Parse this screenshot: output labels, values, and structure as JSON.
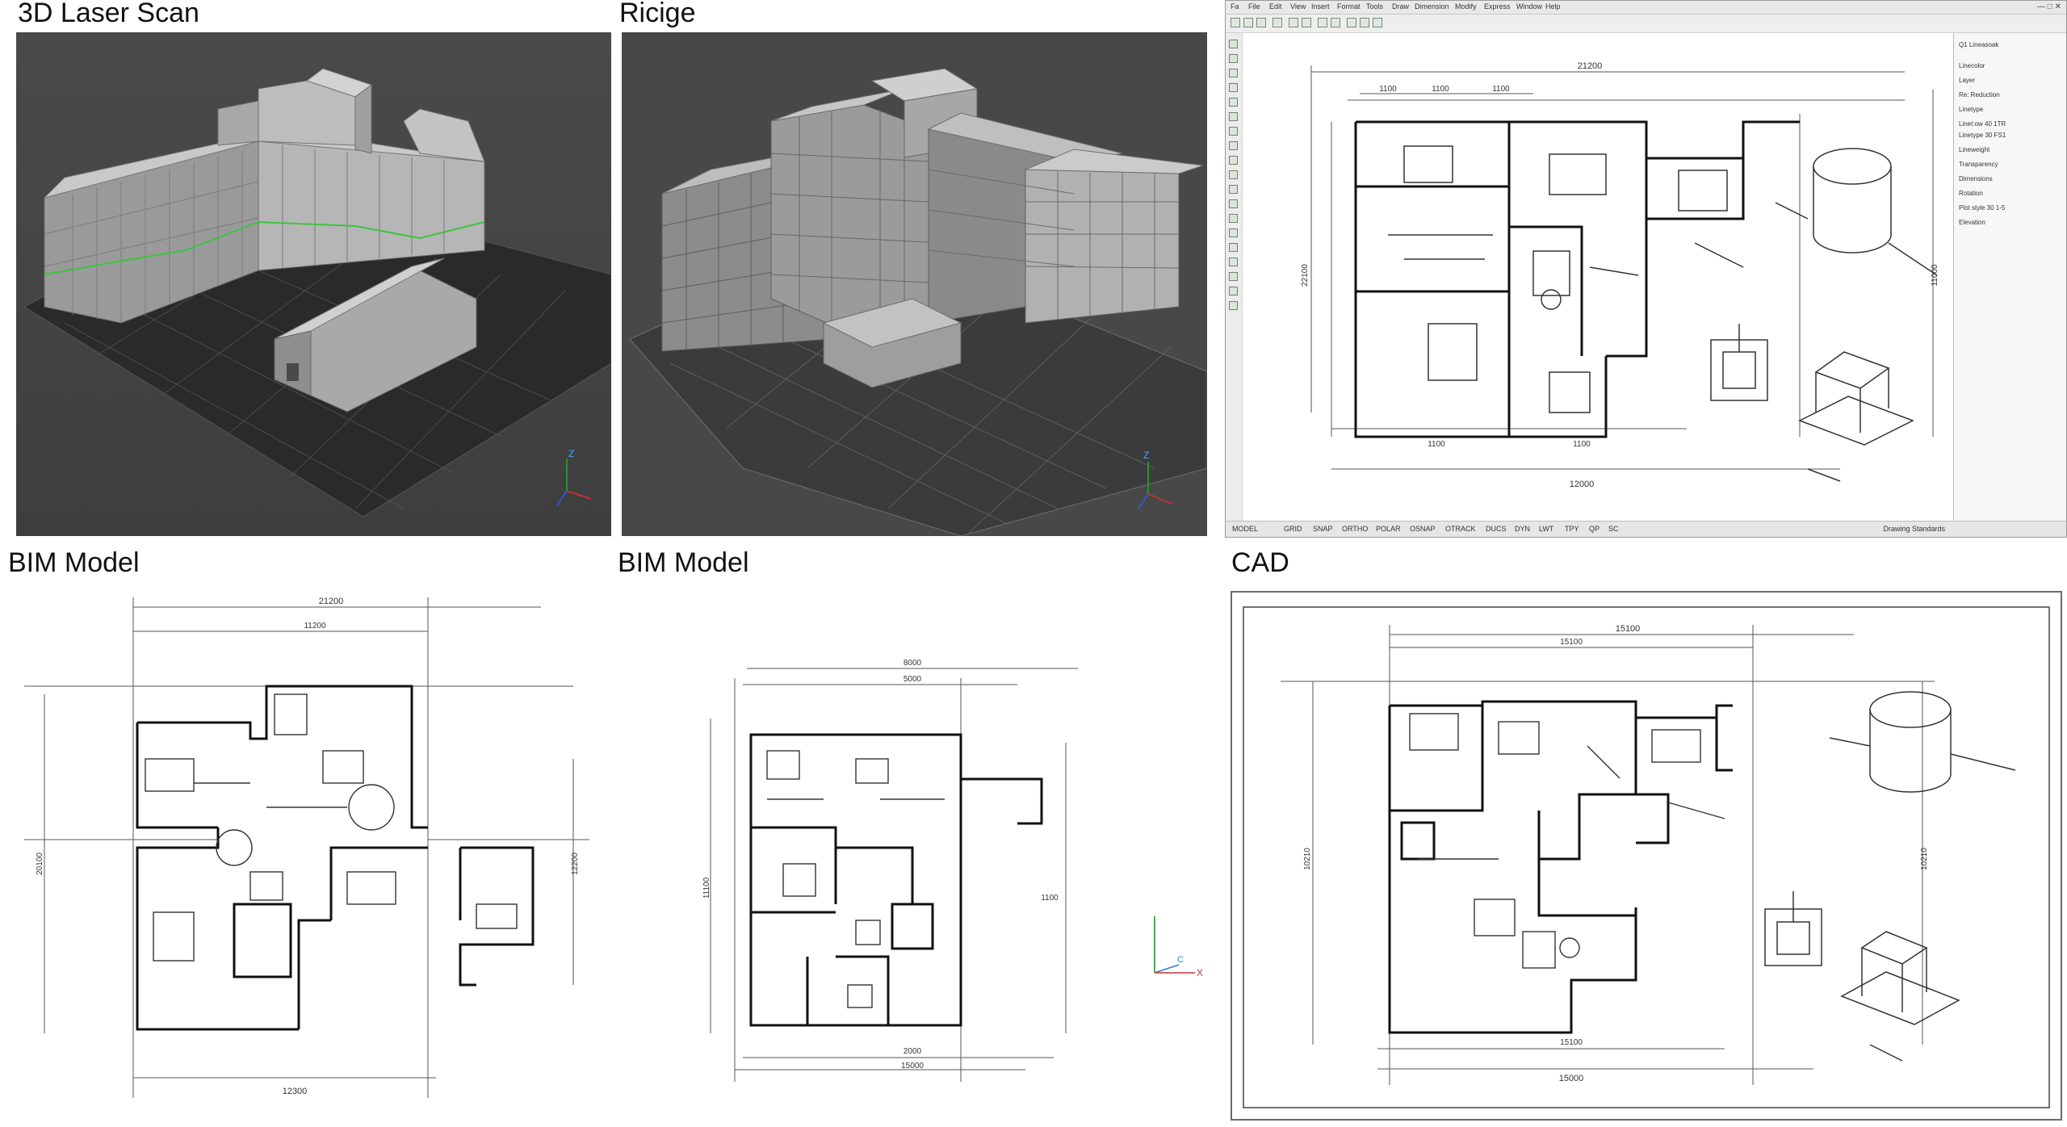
{
  "panels": {
    "laser_scan": {
      "title": "3D Laser Scan",
      "axis_labels": {
        "z": "Z"
      }
    },
    "ricige": {
      "title": "Ricige",
      "axis_labels": {
        "z": "Z"
      }
    },
    "bim_left": {
      "title": "BIM Model",
      "dims": {
        "top_overall": "21200",
        "top_inner": "11200",
        "bottom": "12300",
        "left_side": "20100",
        "right_side": "12200"
      }
    },
    "bim_right": {
      "title": "BIM Model",
      "dims": {
        "top_overall": "8000",
        "top_inner": "5000",
        "bottom_inner": "2000",
        "bottom_overall": "15000",
        "left_side": "11100",
        "right_side": "1100"
      },
      "axis_labels": {
        "x": "X",
        "y": "C"
      }
    },
    "cad": {
      "title": "CAD",
      "dims": {
        "top_overall": "15100",
        "top_inner": "15100",
        "bottom_inner": "15100",
        "bottom_overall": "15000",
        "left_side": "10210",
        "right_side": "10210"
      }
    }
  },
  "cad_app": {
    "menu_items": [
      "Fa",
      "File",
      "Edit",
      "View",
      "Insert",
      "Format",
      "Tools",
      "Draw",
      "Dimension",
      "Modify",
      "Express",
      "Window",
      "Help"
    ],
    "dims": {
      "top": "21200",
      "top_sub_1": "1100",
      "top_sub_2": "1100",
      "top_sub_3": "1100",
      "left_side": "22100",
      "right_side": "11000",
      "bottom_inner": "1100",
      "bottom_mid": "1100",
      "bottom_overall": "12000"
    },
    "properties": [
      "Q1 Lineasoak",
      "Linecolor",
      "Layer",
      "Re: Reduction",
      "Linetype",
      "Linet:ow  40 1TR",
      "Linetype  30 FS1",
      "Lineweight",
      "Transparency",
      "Dimensions",
      "Rotation",
      "Plot style  30 1-5",
      "Elevation"
    ],
    "status_items": [
      "MODEL",
      "GRID",
      "SNAP",
      "ORTHO",
      "POLAR",
      "OSNAP",
      "OTRACK",
      "DUCS",
      "DYN",
      "LWT",
      "TPY",
      "QP",
      "SC"
    ],
    "status_right": "Drawing Standards"
  }
}
